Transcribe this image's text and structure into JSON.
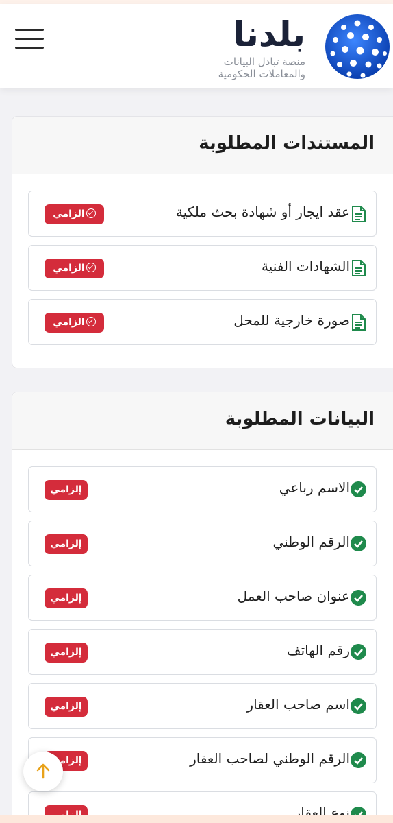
{
  "header": {
    "brand_name": "بلدنا",
    "brand_sub_line1": "منصة تبادل البيانات",
    "brand_sub_line2": "والمعاملات الحكومية",
    "logo_icon": "blue-dotted-sphere-logo",
    "menu_icon": "hamburger-menu-icon"
  },
  "documents": {
    "title": "المستندات المطلوبة",
    "badge_label": "الزامي",
    "items": [
      {
        "label": "عقد ايجار أو شهادة بحث ملكية"
      },
      {
        "label": "الشهادات الفنية"
      },
      {
        "label": "صورة خارجية للمحل"
      }
    ]
  },
  "data_fields": {
    "title": "البيانات المطلوبة",
    "badge_label": "إلزامي",
    "items": [
      {
        "label": "الاسم رباعي"
      },
      {
        "label": "الرقم الوطني"
      },
      {
        "label": "عنوان صاحب العمل"
      },
      {
        "label": "رقم الهاتف"
      },
      {
        "label": "اسم صاحب العقار"
      },
      {
        "label": "الرقم الوطني لصاحب العقار"
      },
      {
        "label": "نوع العقار"
      }
    ]
  },
  "colors": {
    "badge": "#d42c3b",
    "check": "#1f8a4c",
    "logo": "#1f5fd1"
  },
  "fab_icon": "arrow-up-icon"
}
